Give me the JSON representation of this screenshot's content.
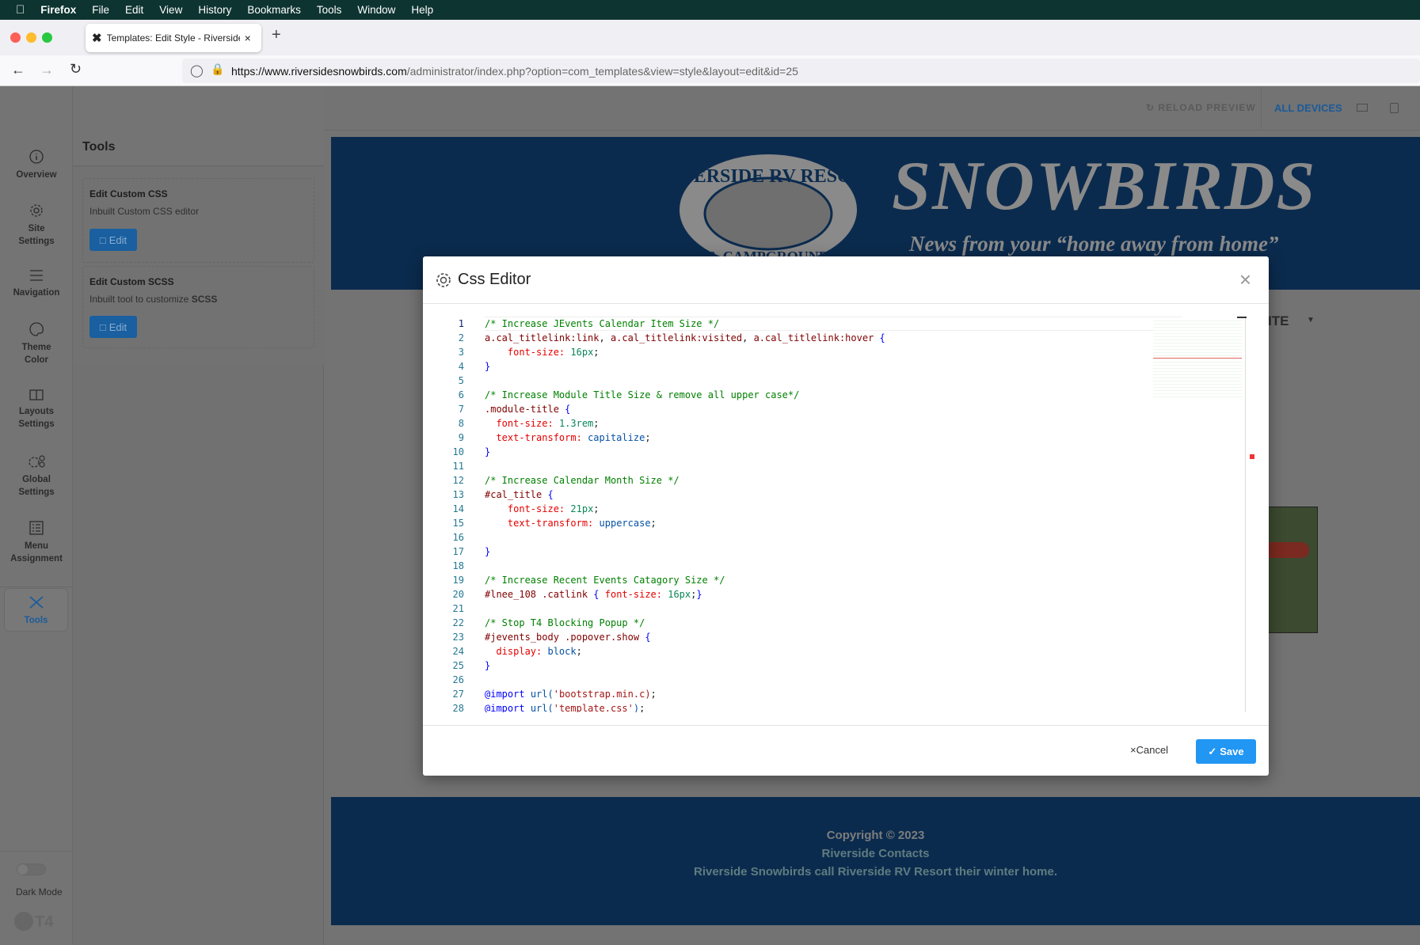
{
  "menubar": {
    "app": "Firefox",
    "items": [
      "File",
      "Edit",
      "View",
      "History",
      "Bookmarks",
      "Tools",
      "Window",
      "Help"
    ]
  },
  "browser": {
    "tab_title": "Templates: Edit Style - Riverside",
    "url_host": "https://www.riversidesnowbirds.com",
    "url_path": "/administrator/index.php?option=com_templates&view=style&layout=edit&id=25"
  },
  "sidebar": {
    "items": [
      {
        "label": "Overview",
        "icon": "info-icon"
      },
      {
        "label": "Site Settings",
        "icon": "gear-icon"
      },
      {
        "label": "Navigation",
        "icon": "menu-icon"
      },
      {
        "label": "Theme Color",
        "icon": "palette-icon"
      },
      {
        "label": "Layouts Settings",
        "icon": "layout-icon"
      },
      {
        "label": "Global Settings",
        "icon": "gears-icon"
      },
      {
        "label": "Menu Assignment",
        "icon": "list-icon"
      },
      {
        "label": "Tools",
        "icon": "tools-icon",
        "active": true
      }
    ],
    "dark_mode": "Dark Mode",
    "logo": "T4"
  },
  "tools": {
    "title": "Tools",
    "cards": [
      {
        "title": "Edit Custom CSS",
        "desc": "Inbuilt Custom CSS editor",
        "button": "Edit"
      },
      {
        "title": "Edit Custom SCSS",
        "desc": "Inbuilt tool to customize ",
        "desc_bold": "SCSS",
        "button": "Edit"
      }
    ]
  },
  "preview": {
    "reload": "RELOAD PREVIEW",
    "all_devices": "ALL DEVICES",
    "logo_ring": "RIVERSIDE RV RESORT",
    "logo_bottom": "& CAMPGROUND",
    "site_name": "SNOWBIRDS",
    "tagline": "News from your “home away from home”",
    "nav_item": "WEBSITE",
    "footer": [
      "Copyright © 2023",
      "Riverside Contacts",
      "Riverside Snowbirds call Riverside RV Resort their winter home."
    ]
  },
  "modal": {
    "title": "Css Editor",
    "cancel": "Cancel",
    "save": "Save",
    "code": [
      [
        [
          "c",
          "/* Increase JEvents Calendar Item Size */"
        ]
      ],
      [
        [
          "s",
          "a.cal_titlelink:link"
        ],
        [
          "t",
          ", "
        ],
        [
          "s",
          "a.cal_titlelink:visited"
        ],
        [
          "t",
          ", "
        ],
        [
          "s",
          "a.cal_titlelink:hover"
        ],
        [
          "t",
          " "
        ],
        [
          "b",
          "{"
        ]
      ],
      [
        [
          "t",
          "    "
        ],
        [
          "p",
          "font-size:"
        ],
        [
          "t",
          " "
        ],
        [
          "n",
          "16px"
        ],
        [
          "t",
          ";"
        ]
      ],
      [
        [
          "b",
          "}"
        ]
      ],
      [],
      [
        [
          "c",
          "/* Increase Module Title Size & remove all upper case*/"
        ]
      ],
      [
        [
          "s",
          ".module-title"
        ],
        [
          "t",
          " "
        ],
        [
          "b",
          "{"
        ]
      ],
      [
        [
          "t",
          "  "
        ],
        [
          "p",
          "font-size:"
        ],
        [
          "t",
          " "
        ],
        [
          "n",
          "1.3rem"
        ],
        [
          "t",
          ";"
        ]
      ],
      [
        [
          "t",
          "  "
        ],
        [
          "p",
          "text-transform:"
        ],
        [
          "t",
          " "
        ],
        [
          "v",
          "capitalize"
        ],
        [
          "t",
          ";"
        ]
      ],
      [
        [
          "b",
          "}"
        ]
      ],
      [],
      [
        [
          "c",
          "/* Increase Calendar Month Size */"
        ]
      ],
      [
        [
          "s",
          "#cal_title"
        ],
        [
          "t",
          " "
        ],
        [
          "b",
          "{"
        ]
      ],
      [
        [
          "t",
          "    "
        ],
        [
          "p",
          "font-size:"
        ],
        [
          "t",
          " "
        ],
        [
          "n",
          "21px"
        ],
        [
          "t",
          ";"
        ]
      ],
      [
        [
          "t",
          "    "
        ],
        [
          "p",
          "text-transform:"
        ],
        [
          "t",
          " "
        ],
        [
          "v",
          "uppercase"
        ],
        [
          "t",
          ";"
        ]
      ],
      [],
      [
        [
          "b",
          "}"
        ]
      ],
      [],
      [
        [
          "c",
          "/* Increase Recent Events Catagory Size */"
        ]
      ],
      [
        [
          "s",
          "#lnee_108 .catlink"
        ],
        [
          "t",
          " "
        ],
        [
          "b",
          "{"
        ],
        [
          "t",
          " "
        ],
        [
          "p",
          "font-size:"
        ],
        [
          "t",
          " "
        ],
        [
          "n",
          "16px"
        ],
        [
          "t",
          ";"
        ],
        [
          "b",
          "}"
        ]
      ],
      [],
      [
        [
          "c",
          "/* Stop T4 Blocking Popup */"
        ]
      ],
      [
        [
          "s",
          "#jevents_body .popover.show"
        ],
        [
          "t",
          " "
        ],
        [
          "b",
          "{"
        ]
      ],
      [
        [
          "t",
          "  "
        ],
        [
          "p",
          "display:"
        ],
        [
          "t",
          " "
        ],
        [
          "v",
          "block"
        ],
        [
          "t",
          ";"
        ]
      ],
      [
        [
          "b",
          "}"
        ]
      ],
      [],
      [
        [
          "a",
          "@import"
        ],
        [
          "t",
          " "
        ],
        [
          "v",
          "url("
        ],
        [
          "str",
          "'bootstrap.min.c)"
        ],
        [
          "t",
          ";"
        ]
      ],
      [
        [
          "a",
          "@import"
        ],
        [
          "t",
          " "
        ],
        [
          "v",
          "url("
        ],
        [
          "str",
          "'template.css'"
        ],
        [
          "v",
          ")"
        ],
        [
          "t",
          ";"
        ]
      ]
    ]
  },
  "colors": {
    "accent": "#2196f3",
    "menubar": "#0d3431",
    "header": "#0b2b4e"
  }
}
